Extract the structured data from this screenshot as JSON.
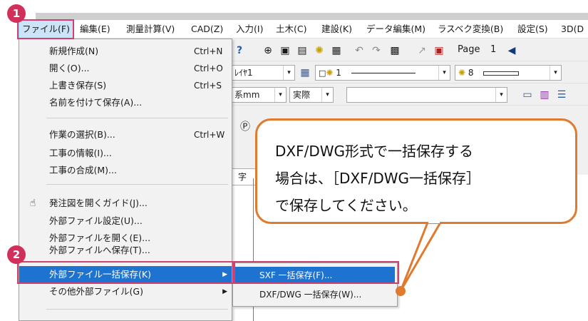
{
  "menubar": {
    "items": [
      "ファイル(F)",
      "編集(E)",
      "測量計算(V)",
      "CAD(Z)",
      "入力(I)",
      "土木(C)",
      "建設(K)",
      "データ編集(M)",
      "ラスベク変換(B)",
      "設定(S)",
      "3D(D"
    ]
  },
  "toolbar": {
    "page_label": "Page",
    "page_number": "1",
    "layer_value": "ﾚｲﾔ1",
    "pen_value": "1",
    "bulb_value": "8",
    "unit_value": "系mm",
    "scale_value": "実際",
    "text_tool": "字"
  },
  "file_menu": {
    "items": [
      {
        "label": "新規作成(N)",
        "shortcut": "Ctrl+N"
      },
      {
        "label": "開く(O)...",
        "shortcut": "Ctrl+O"
      },
      {
        "label": "上書き保存(S)",
        "shortcut": "Ctrl+S"
      },
      {
        "label": "名前を付けて保存(A)...",
        "shortcut": ""
      },
      {
        "label": "作業の選択(B)...",
        "shortcut": "Ctrl+W"
      },
      {
        "label": "工事の情報(I)...",
        "shortcut": ""
      },
      {
        "label": "工事の合成(M)...",
        "shortcut": ""
      },
      {
        "label": "発注図を開くガイド(J)...",
        "shortcut": ""
      },
      {
        "label": "外部ファイル設定(U)...",
        "shortcut": ""
      },
      {
        "label": "外部ファイルを開く(E)...",
        "shortcut": ""
      },
      {
        "label": "外部ファイルへ保存(T)...",
        "shortcut": ""
      },
      {
        "label": "外部ファイル一括保存(K)",
        "shortcut": ""
      },
      {
        "label": "その他外部ファイル(G)",
        "shortcut": ""
      }
    ]
  },
  "sub_menu": {
    "items": [
      "SXF 一括保存(F)...",
      "DXF/DWG 一括保存(W)..."
    ]
  },
  "badges": [
    "1",
    "2"
  ],
  "callout": {
    "lines": [
      "DXF/DWG形式で一括保存する",
      "場合は、［DXF/DWG一括保存］",
      "で保存してください。"
    ]
  },
  "colors": {
    "accent_pink": "#d0305a",
    "callout_orange": "#e07a2e",
    "menu_highlight": "#1f73d0"
  },
  "icons": [
    "hand-pointer-icon",
    "zoom-icon",
    "bulb-icon",
    "undo-icon",
    "redo-icon"
  ]
}
